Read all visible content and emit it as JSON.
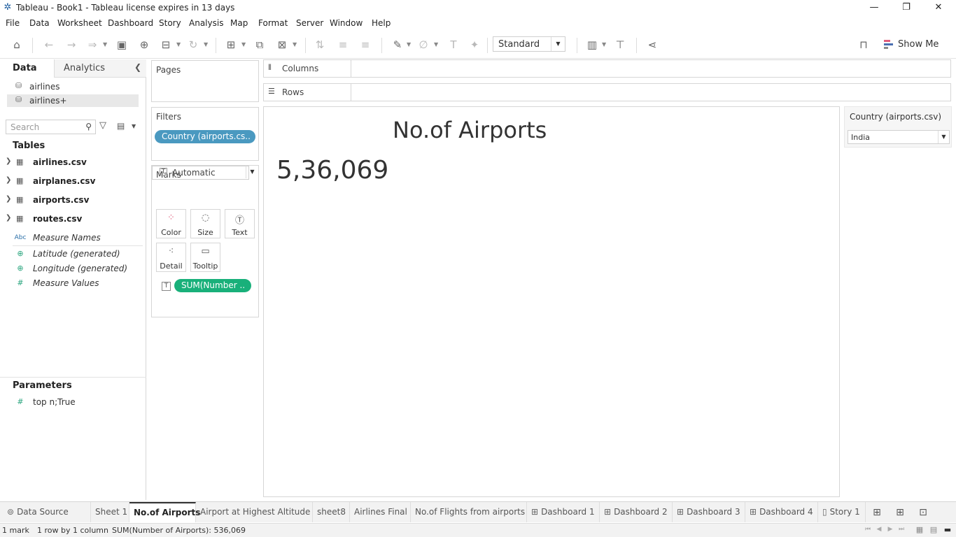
{
  "window": {
    "title": "Tableau - Book1 - Tableau license expires in 13 days",
    "controls": {
      "minimize": "—",
      "restore": "❐",
      "close": "✕"
    }
  },
  "menu": [
    "File",
    "Data",
    "Worksheet",
    "Dashboard",
    "Story",
    "Analysis",
    "Map",
    "Format",
    "Server",
    "Window",
    "Help"
  ],
  "toolbar": {
    "fit_mode": "Standard",
    "show_me": "Show Me"
  },
  "left_pane": {
    "tabs": {
      "data": "Data",
      "analytics": "Analytics"
    },
    "data_sources": [
      "airlines",
      "airlines+"
    ],
    "search_placeholder": "Search",
    "tables_title": "Tables",
    "tables": [
      "airlines.csv",
      "airplanes.csv",
      "airports.csv",
      "routes.csv"
    ],
    "fields": [
      {
        "icon": "abc-icon",
        "glyph": "Abc",
        "label": "Measure Names"
      },
      {
        "icon": "globe-icon",
        "glyph": "⊕",
        "label": "Latitude (generated)"
      },
      {
        "icon": "globe-icon",
        "glyph": "⊕",
        "label": "Longitude (generated)"
      },
      {
        "icon": "hash-icon",
        "glyph": "#",
        "label": "Measure Values"
      }
    ],
    "parameters_title": "Parameters",
    "parameters": [
      "top n;True"
    ]
  },
  "cards": {
    "pages": "Pages",
    "filters": "Filters",
    "filter_pill": "Country (airports.cs..",
    "marks": "Marks",
    "mark_type": "Automatic",
    "mark_buttons": {
      "color": "Color",
      "size": "Size",
      "text": "Text",
      "detail": "Detail",
      "tooltip": "Tooltip"
    },
    "text_pill": "SUM(Number .."
  },
  "shelves": {
    "columns": "Columns",
    "rows": "Rows"
  },
  "viz": {
    "title": "No.of Airports",
    "value": "5,36,069"
  },
  "quick_filter": {
    "title": "Country (airports.csv)",
    "value": "India"
  },
  "sheet_tabs": [
    {
      "label": "Data Source",
      "icon": "database-icon",
      "glyph": "⊚",
      "active": false
    },
    {
      "label": "Sheet 1",
      "icon": "",
      "glyph": "",
      "active": false
    },
    {
      "label": "No.of Airports",
      "icon": "",
      "glyph": "",
      "active": true
    },
    {
      "label": "Airport  at Highest Altitude",
      "icon": "",
      "glyph": "",
      "active": false
    },
    {
      "label": "sheet8",
      "icon": "",
      "glyph": "",
      "active": false
    },
    {
      "label": "Airlines Final",
      "icon": "",
      "glyph": "",
      "active": false
    },
    {
      "label": "No.of Flights from airports",
      "icon": "",
      "glyph": "",
      "active": false
    },
    {
      "label": "Dashboard 1",
      "icon": "dashboard-icon",
      "glyph": "⊞",
      "active": false
    },
    {
      "label": "Dashboard 2",
      "icon": "dashboard-icon",
      "glyph": "⊞",
      "active": false
    },
    {
      "label": "Dashboard 3",
      "icon": "dashboard-icon",
      "glyph": "⊞",
      "active": false
    },
    {
      "label": "Dashboard 4",
      "icon": "dashboard-icon",
      "glyph": "⊞",
      "active": false
    },
    {
      "label": "Story 1",
      "icon": "story-icon",
      "glyph": "▯",
      "active": false
    }
  ],
  "status": {
    "marks": "1 mark",
    "dims": "1 row by 1 column",
    "sum": "SUM(Number of Airports): 536,069"
  }
}
